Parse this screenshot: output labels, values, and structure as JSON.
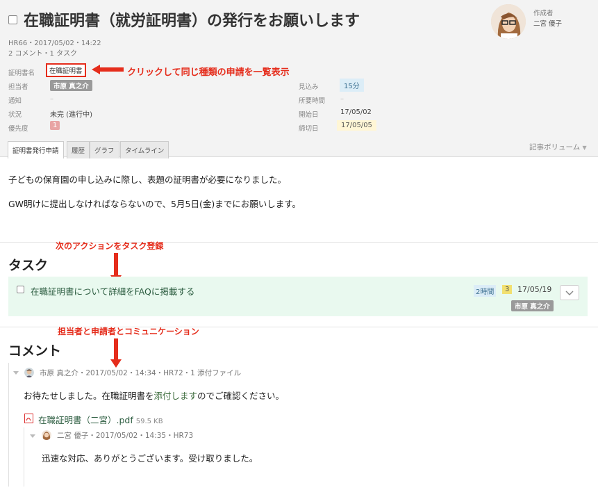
{
  "header": {
    "title": "在職証明書（就労証明書）の発行をお願いします",
    "meta_line1": "HR66・2017/05/02・14:22",
    "meta_line2": "2 コメント・1 タスク",
    "author_label": "作成者",
    "author_name": "二宮 優子"
  },
  "fields": {
    "cert_name_label": "証明書名",
    "cert_name_value": "在職証明書",
    "assignee_label": "担当者",
    "assignee_value": "市原 真之介",
    "notify_label": "通知",
    "notify_value": "–",
    "status_label": "状況",
    "status_value": "未完 (進行中)",
    "priority_label": "優先度",
    "priority_value": "1",
    "estimate_label": "見込み",
    "estimate_value": "15分",
    "required_label": "所要時間",
    "required_value": "–",
    "start_label": "開始日",
    "start_value": "17/05/02",
    "due_label": "締切日",
    "due_value": "17/05/05"
  },
  "annotations": {
    "cert_click": "クリックして同じ種類の申請を一覧表示",
    "task_action": "次のアクションをタスク登録",
    "comm": "担当者と申請者とコミュニケーション"
  },
  "tabs": {
    "t1": "証明書発行申請",
    "t2": "履歴",
    "t3": "グラフ",
    "t4": "タイムライン",
    "volume": "記事ボリューム"
  },
  "body": {
    "line1": "子どもの保育園の申し込みに際し、表題の証明書が必要になりました。",
    "line2": "GW明けに提出しなければならないので、5月5日(金)までにお願いします。"
  },
  "tasks": {
    "title": "タスク",
    "item": {
      "text": "在職証明書について詳細をFAQに掲載する",
      "hours": "2時間",
      "priority": "3",
      "date": "17/05/19",
      "assignee": "市原 真之介"
    }
  },
  "comments": {
    "title": "コメント",
    "c1": {
      "meta": "市原 真之介・2017/05/02・14:34・HR72・1 添付ファイル",
      "text_before": "お待たせしました。在職証明書を",
      "text_link": "添付します",
      "text_after": "のでご確認ください。",
      "file_name": "在職証明書（二宮）.pdf",
      "file_size": "59.5 KB"
    },
    "c2": {
      "meta": "二宮 優子・2017/05/02・14:35・HR73",
      "text": "迅速な対応、ありがとうございます。受け取りました。"
    }
  },
  "colors": {
    "annotation_red": "#e52d1c",
    "task_bg": "#e9f9ef",
    "header_bg": "#f3f3f3"
  }
}
